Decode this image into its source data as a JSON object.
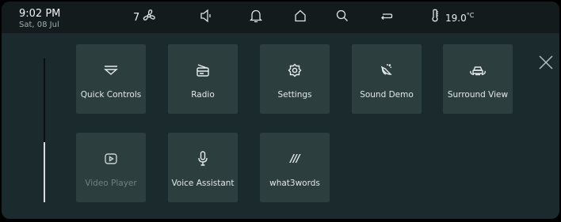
{
  "status": {
    "time": "9:02 PM",
    "date": "Sat, 08 Jul",
    "fan_level": "7",
    "temperature": "19.0",
    "temperature_unit": "°C"
  },
  "icons": {
    "fan": "fan-icon",
    "volume": "volume-icon",
    "notifications": "bell-icon",
    "home": "home-icon",
    "search": "search-icon",
    "back": "back-arrow-icon",
    "temperature": "thermometer-icon",
    "close": "close-icon"
  },
  "scrollbar": {
    "position": "end"
  },
  "tiles": [
    {
      "label": "Quick Controls",
      "icon": "quick-controls-icon",
      "enabled": true
    },
    {
      "label": "Radio",
      "icon": "radio-icon",
      "enabled": true
    },
    {
      "label": "Settings",
      "icon": "gear-icon",
      "enabled": true
    },
    {
      "label": "Sound Demo",
      "icon": "sound-demo-icon",
      "enabled": true
    },
    {
      "label": "Surround View",
      "icon": "car-surround-icon",
      "enabled": true
    },
    {
      "label": "Video Player",
      "icon": "video-play-icon",
      "enabled": false
    },
    {
      "label": "Voice Assistant",
      "icon": "microphone-icon",
      "enabled": true
    },
    {
      "label": "what3words",
      "icon": "what3words-icon",
      "icon_text": "///",
      "enabled": true
    }
  ],
  "colors": {
    "background": "#1b2a2d",
    "statusbar": "#131b1d",
    "tile": "#2d3e3f",
    "text": "#e2e8e8",
    "disabled_text": "#6f8183"
  }
}
